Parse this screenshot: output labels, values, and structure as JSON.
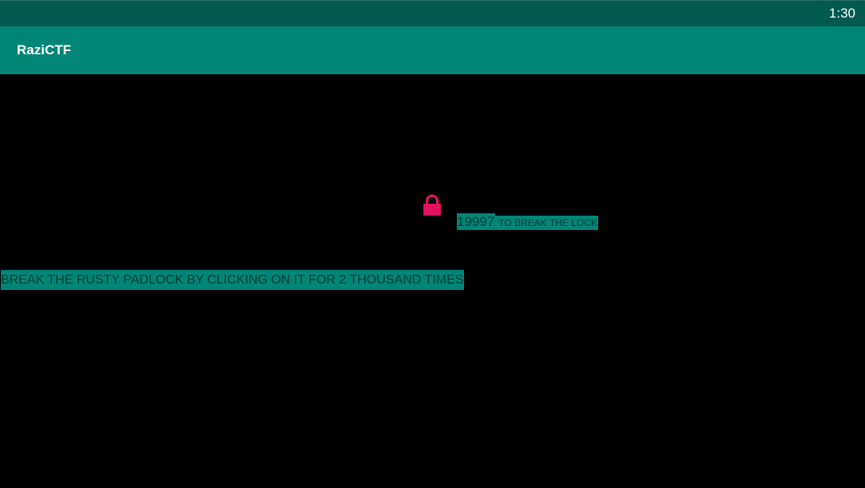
{
  "status_bar": {
    "time": "1:30"
  },
  "app_bar": {
    "title": "RaziCTF"
  },
  "lock": {
    "icon": "lock-icon",
    "color": "#e0115f",
    "counter": "19997",
    "counter_suffix": "TO BREAK THE LOCK"
  },
  "instruction": {
    "text": "BREAK THE RUSTY PADLOCK BY CLICKING ON IT FOR 2 THOUSAND TIMES"
  },
  "colors": {
    "status_bar": "#005a4f",
    "app_bar": "#008577",
    "highlight": "#008577",
    "background": "#000000"
  }
}
